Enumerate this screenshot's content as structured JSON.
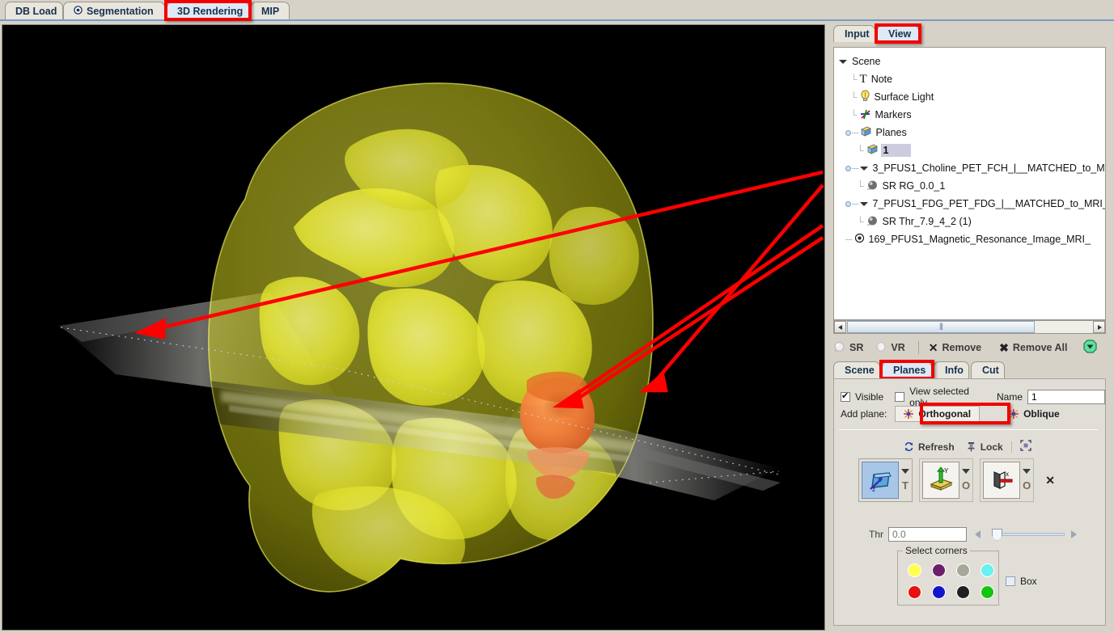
{
  "top_tabs": [
    {
      "label": "DB Load",
      "icon": "none",
      "selected": false
    },
    {
      "label": "Segmentation",
      "icon": "target-icon",
      "selected": false
    },
    {
      "label": "3D Rendering",
      "icon": "none",
      "selected": true,
      "highlighted": true
    },
    {
      "label": "MIP",
      "icon": "none",
      "selected": false
    }
  ],
  "panel_tabs": [
    {
      "label": "Input",
      "selected": false
    },
    {
      "label": "View",
      "selected": true,
      "highlighted": true
    }
  ],
  "tree": {
    "root": "Scene",
    "items": [
      {
        "label": "Scene",
        "depth": 0,
        "icon": "twisty-open",
        "selected": false
      },
      {
        "label": "Note",
        "depth": 1,
        "icon": "text-T-icon",
        "selected": false
      },
      {
        "label": "Surface Light",
        "depth": 1,
        "icon": "lightbulb-icon",
        "selected": false
      },
      {
        "label": "Markers",
        "depth": 1,
        "icon": "axes-markers-icon",
        "selected": false
      },
      {
        "label": "Planes",
        "depth": 1,
        "icon": "cube-icon",
        "selected": false,
        "expandable": true
      },
      {
        "label": "1",
        "depth": 2,
        "icon": "cube-icon",
        "selected": true
      },
      {
        "label": "3_PFUS1_Choline_PET_FCH_|__MATCHED_to_M",
        "depth": 1,
        "icon": "twisty-open",
        "selected": false
      },
      {
        "label": "SR RG_0.0_1",
        "depth": 2,
        "icon": "sphere-icon",
        "selected": false
      },
      {
        "label": "7_PFUS1_FDG_PET_FDG_|__MATCHED_to_MRI_",
        "depth": 1,
        "icon": "twisty-open",
        "selected": false
      },
      {
        "label": "SR Thr_7.9_4_2 (1)",
        "depth": 2,
        "icon": "sphere-icon",
        "selected": false
      },
      {
        "label": "169_PFUS1_Magnetic_Resonance_Image_MRI_",
        "depth": 1,
        "icon": "target-icon",
        "selected": false
      }
    ]
  },
  "actions": {
    "sr_label": "SR",
    "vr_label": "VR",
    "remove_label": "Remove",
    "remove_all_label": "Remove All",
    "dropdown_icon": "green-chevron-down-icon"
  },
  "sub_tabs": [
    {
      "label": "Scene",
      "selected": false
    },
    {
      "label": "Planes",
      "selected": true,
      "highlighted": true
    },
    {
      "label": "Info",
      "selected": false
    },
    {
      "label": "Cut",
      "selected": false
    }
  ],
  "planes": {
    "visible_label": "Visible",
    "visible_checked": true,
    "view_selected_only_label": "View selected only",
    "view_selected_only_checked": false,
    "name_label": "Name",
    "name_value": "1",
    "add_plane_label": "Add plane:",
    "orthogonal_label": "Orthogonal",
    "orthogonal_highlighted": true,
    "oblique_label": "Oblique",
    "refresh_label": "Refresh",
    "lock_label": "Lock",
    "fit_icon": "fit-to-window-icon",
    "orientation_buttons": [
      {
        "axis": "Z",
        "sub_label": "T",
        "selected": true,
        "icon": "transverse-plane-icon"
      },
      {
        "axis": "Y",
        "sub_label": "O",
        "selected": false,
        "icon": "coronal-plane-icon"
      },
      {
        "axis": "X",
        "sub_label": "O",
        "selected": false,
        "icon": "sagittal-plane-icon"
      }
    ],
    "close_icon": "close-x-icon",
    "thr_label": "Thr",
    "thr_placeholder": "0.0",
    "thr_value": "",
    "slider_position_pct": 8,
    "corners_label": "Select corners",
    "corner_colors": [
      "#ffff4d",
      "#6b1f6b",
      "#a8a89a",
      "#66f2f2",
      "#e81010",
      "#1414c8",
      "#1f1f1f",
      "#13c413"
    ],
    "box_label": "Box",
    "box_checked": false
  },
  "viewport": {
    "background": "#000000",
    "surface_color": "#d8d820",
    "hotspot_color": "#f0803c",
    "annotation_color": "#ff0000",
    "annotation_arrows": [
      {
        "from": [
          1033,
          183
        ],
        "to": [
          172,
          379
        ],
        "label": "arrow-to-plane-edge"
      },
      {
        "from": [
          1033,
          196
        ],
        "to": [
          795,
          447
        ],
        "label": "arrow-to-plane-right"
      },
      {
        "from": [
          1033,
          249
        ],
        "to": [
          688,
          469
        ],
        "label": "arrow-to-hotspot"
      },
      {
        "from": [
          1033,
          262
        ],
        "to": [
          690,
          474
        ],
        "label": "arrow-to-hotspot-2"
      }
    ]
  }
}
